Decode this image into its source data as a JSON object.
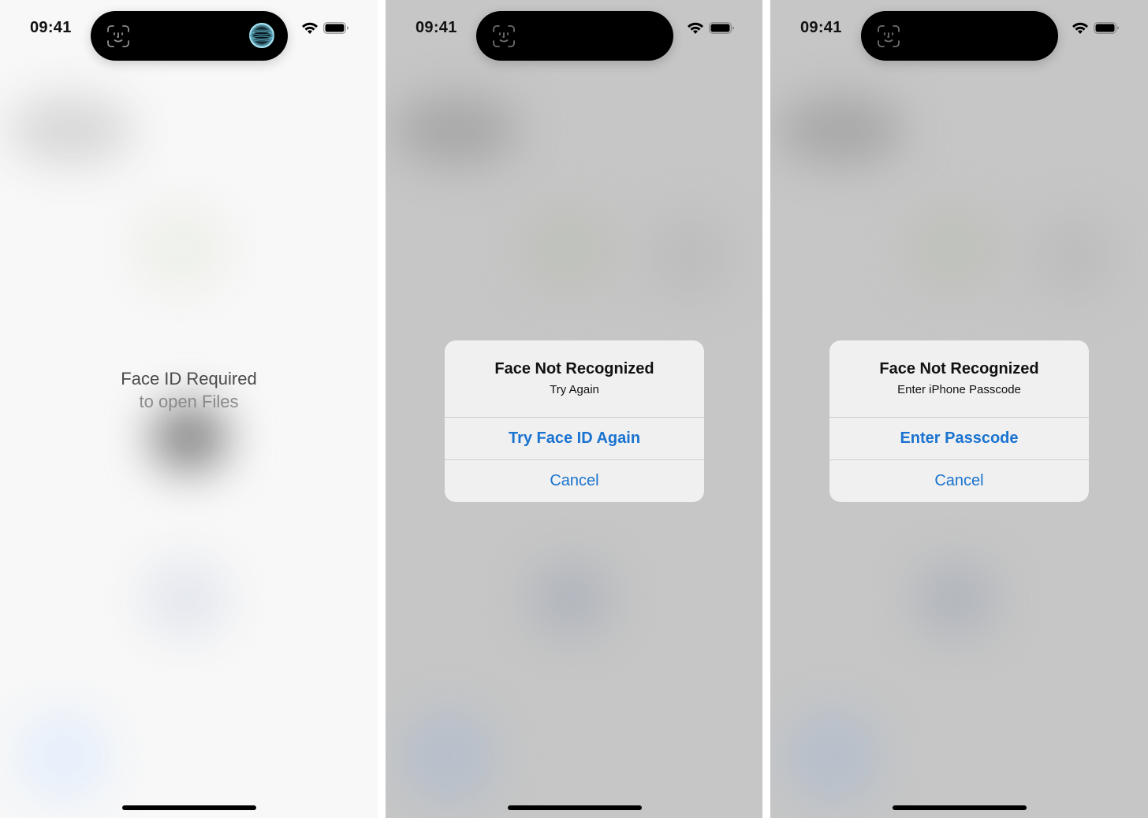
{
  "status_bar": {
    "time": "09:41"
  },
  "colors": {
    "accent": "#1a73d0",
    "alert_background": "#f2f2f2",
    "dimmed_background": "#c6c6c6",
    "light_background": "#f8f8f8"
  },
  "panels": [
    {
      "state": "scanning",
      "island_icons": [
        "face-id-icon",
        "face-id-scanning-orb-icon"
      ],
      "prompt": {
        "line1": "Face ID Required",
        "line2": "to open Files"
      }
    },
    {
      "state": "failed",
      "island_icons": [
        "face-id-icon"
      ],
      "alert": {
        "title": "Face Not Recognized",
        "message": "Try Again",
        "primary_button": "Try Face ID Again",
        "cancel_button": "Cancel"
      }
    },
    {
      "state": "failed-passcode",
      "island_icons": [
        "face-id-icon"
      ],
      "alert": {
        "title": "Face Not Recognized",
        "message": "Enter iPhone Passcode",
        "primary_button": "Enter Passcode",
        "cancel_button": "Cancel"
      }
    }
  ]
}
